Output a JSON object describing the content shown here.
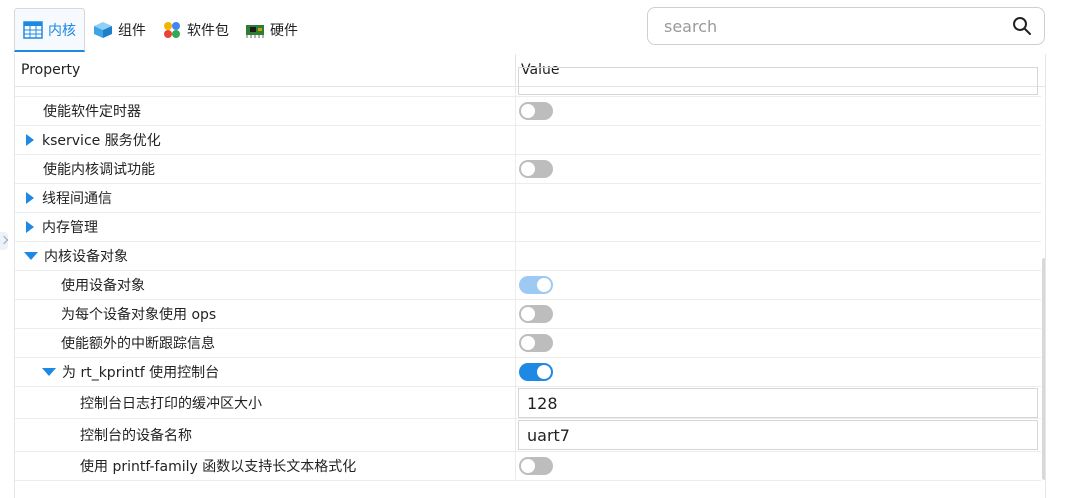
{
  "tabs": [
    {
      "label": "内核",
      "icon": "table-grid-icon",
      "active": true
    },
    {
      "label": "组件",
      "icon": "cube-icon",
      "active": false
    },
    {
      "label": "软件包",
      "icon": "packages-icon",
      "active": false
    },
    {
      "label": "硬件",
      "icon": "circuit-board-icon",
      "active": false
    }
  ],
  "search": {
    "placeholder": "search",
    "value": ""
  },
  "table": {
    "header": {
      "property": "Property",
      "value": "Value"
    },
    "rows": [
      {
        "label": "使能软件定时器",
        "type": "toggle",
        "state": "off"
      },
      {
        "label": "kservice 服务优化",
        "type": "group",
        "expanded": false
      },
      {
        "label": "使能内核调试功能",
        "type": "toggle",
        "state": "off"
      },
      {
        "label": "线程间通信",
        "type": "group",
        "expanded": false
      },
      {
        "label": "内存管理",
        "type": "group",
        "expanded": false
      },
      {
        "label": "内核设备对象",
        "type": "group",
        "expanded": true
      },
      {
        "label": "使用设备对象",
        "type": "toggle",
        "state": "on-disabled"
      },
      {
        "label": "为每个设备对象使用 ops",
        "type": "toggle",
        "state": "off"
      },
      {
        "label": "使能额外的中断跟踪信息",
        "type": "toggle",
        "state": "off"
      },
      {
        "label": "为 rt_kprintf 使用控制台",
        "type": "toggle-group",
        "expanded": true,
        "state": "on"
      },
      {
        "label": "控制台日志打印的缓冲区大小",
        "type": "input",
        "value": "128"
      },
      {
        "label": "控制台的设备名称",
        "type": "input",
        "value": "uart7"
      },
      {
        "label": "使用 printf-family 函数以支持长文本格式化",
        "type": "toggle",
        "state": "off"
      }
    ]
  },
  "colors": {
    "accent": "#1e88e5",
    "toggle_off": "#bdbdbd",
    "toggle_on_disabled": "#9ccaf3"
  }
}
